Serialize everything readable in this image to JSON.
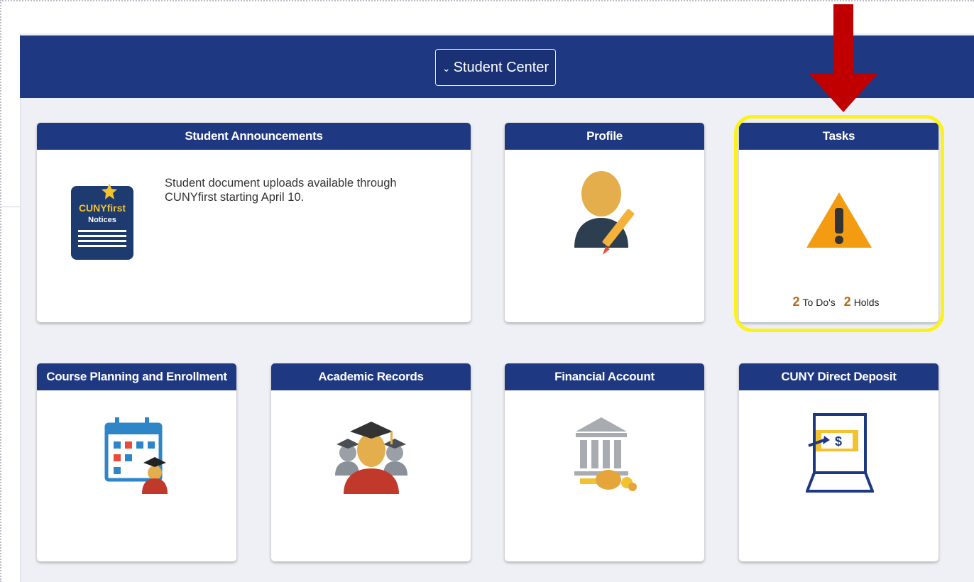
{
  "header": {
    "menu_button": "Student Center",
    "chevron": "chevron-down-icon"
  },
  "tiles": {
    "announcements": {
      "title": "Student Announcements",
      "text": "Student document uploads available through CUNYfirst starting April 10.",
      "icon_logo_line1": "CUNYfirst",
      "icon_logo_line2": "Notices",
      "icon": "cunyfirst-notices-icon"
    },
    "profile": {
      "title": "Profile",
      "icon": "user-edit-icon"
    },
    "tasks": {
      "title": "Tasks",
      "icon": "warning-icon",
      "todo_count": "2",
      "todo_label": "To Do's",
      "holds_count": "2",
      "holds_label": "Holds"
    },
    "course_planning": {
      "title": "Course Planning and Enrollment",
      "icon": "calendar-student-icon"
    },
    "academic_records": {
      "title": "Academic Records",
      "icon": "graduates-icon"
    },
    "financial_account": {
      "title": "Financial Account",
      "icon": "bank-money-icon"
    },
    "direct_deposit": {
      "title": "CUNY Direct Deposit",
      "icon": "laptop-dollar-icon"
    }
  },
  "colors": {
    "header_blue": "#1f3882",
    "highlight_yellow": "#fbf21c",
    "arrow_red": "#c00000",
    "warning_orange": "#f39c12",
    "count_brown": "#b46a18"
  }
}
